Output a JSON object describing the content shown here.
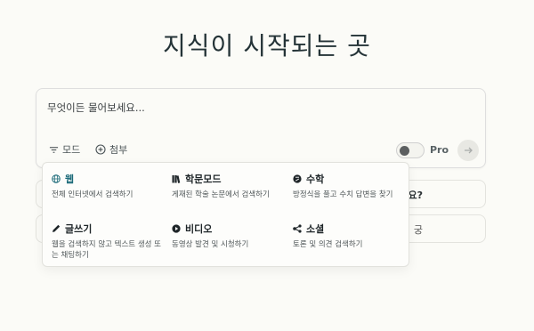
{
  "headline": "지식이 시작되는 곳",
  "search": {
    "placeholder": "무엇이든 물어보세요..."
  },
  "toolbar": {
    "focus_label": "모드",
    "attach_label": "첨부",
    "pro_label": "Pro",
    "pro_enabled": false
  },
  "suggestions": [
    {
      "visible_text": "요?"
    },
    {
      "visible_text": "궁"
    }
  ],
  "focus_menu": {
    "options": [
      {
        "title": "웹",
        "description": "전체 인터넷에서 검색하기",
        "icon": "globe-icon",
        "selected": true
      },
      {
        "title": "학문모드",
        "description": "게재된 학술 논문에서 검색하기",
        "icon": "books-icon",
        "selected": false
      },
      {
        "title": "수학",
        "description": "방정식을 풀고 수치 답변을 찾기",
        "icon": "math-icon",
        "selected": false
      },
      {
        "title": "글쓰기",
        "description": "웹을 검색하지 않고 텍스트 생성 또는 채팅하기",
        "icon": "pencil-icon",
        "selected": false
      },
      {
        "title": "비디오",
        "description": "동영상 발견 및 시청하기",
        "icon": "play-icon",
        "selected": false
      },
      {
        "title": "소셜",
        "description": "토론 및 의견 검색하기",
        "icon": "social-icon",
        "selected": false
      }
    ]
  },
  "colors": {
    "background": "#fbfbf7",
    "accent": "#1d6b7a",
    "text": "#1f2a2e"
  }
}
